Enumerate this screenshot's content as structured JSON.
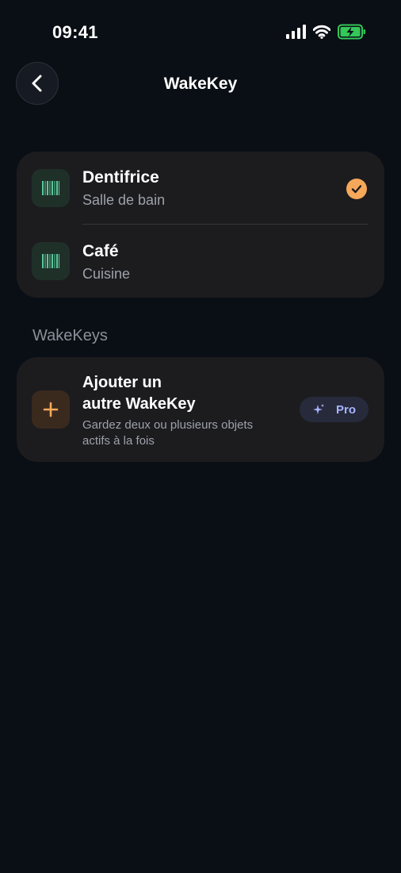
{
  "status_bar": {
    "time": "09:41",
    "icons": [
      "cellular-signal-icon",
      "wifi-icon",
      "battery-charging-icon"
    ],
    "battery_color": "#34c759"
  },
  "header": {
    "title": "WakeKey",
    "back_icon": "chevron-left-icon"
  },
  "objects": [
    {
      "name": "Dentifrice",
      "location": "Salle de bain",
      "icon": "barcode-icon",
      "selected": true
    },
    {
      "name": "Café",
      "location": "Cuisine",
      "icon": "barcode-icon",
      "selected": false
    }
  ],
  "section": {
    "label": "WakeKeys"
  },
  "add_wakekey": {
    "title_line1": "Ajouter un",
    "title_line2": "autre WakeKey",
    "subtitle_line1": "Gardez deux ou plusieurs objets",
    "subtitle_line2": "actifs à la fois",
    "badge": "Pro",
    "badge_icon": "sparkles-icon",
    "icon": "plus-icon"
  },
  "colors": {
    "background": "#0a0e15",
    "card": "#1c1c1f",
    "accent_orange": "#f6a85a",
    "barcode_green": "#5ac79a",
    "pro_purple": "#a8b4ff"
  }
}
